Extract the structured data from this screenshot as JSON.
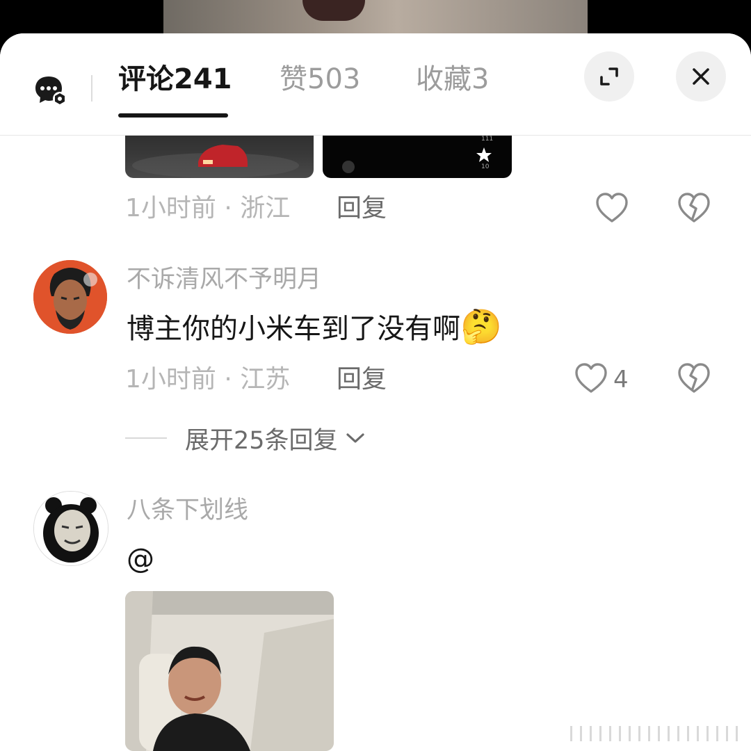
{
  "header": {
    "tabs": [
      {
        "label": "评论241",
        "active": true
      },
      {
        "label": "赞503",
        "active": false
      },
      {
        "label": "收藏3",
        "active": false
      }
    ]
  },
  "comments": [
    {
      "time": "1小时前 · 浙江",
      "reply_label": "回复",
      "likes": ""
    },
    {
      "username": "不诉清风不予明月",
      "text": "博主你的小米车到了没有啊",
      "emoji": "🤔",
      "time": "1小时前 · 江苏",
      "reply_label": "回复",
      "likes": "4",
      "expand_label": "展开25条回复"
    },
    {
      "username": "八条下划线",
      "text": "@"
    }
  ],
  "colors": {
    "text_primary": "#161616",
    "text_secondary": "#b5b5b5",
    "tab_inactive": "#9c9c9c"
  }
}
